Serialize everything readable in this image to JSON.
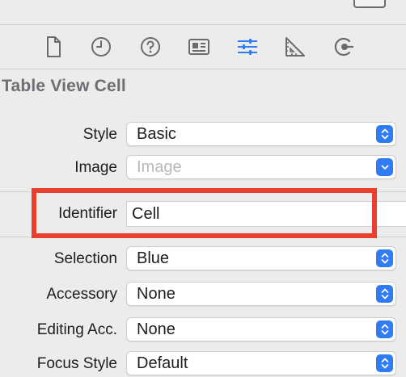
{
  "toolbar": {
    "icons": [
      "file-icon",
      "clock-icon",
      "help-icon",
      "identity-card-icon",
      "sliders-icon",
      "ruler-triangle-icon",
      "connections-icon"
    ],
    "selected": "sliders-icon",
    "accent": "#2f7cf6"
  },
  "section": {
    "title": "Table View Cell"
  },
  "fields": {
    "style": {
      "label": "Style",
      "value": "Basic"
    },
    "image": {
      "label": "Image",
      "placeholder": "Image"
    },
    "identifier": {
      "label": "Identifier",
      "value": "Cell"
    },
    "selection": {
      "label": "Selection",
      "value": "Blue"
    },
    "accessory": {
      "label": "Accessory",
      "value": "None"
    },
    "editing_acc": {
      "label": "Editing Acc.",
      "value": "None"
    },
    "focus_style": {
      "label": "Focus Style",
      "value": "Default"
    }
  },
  "highlight_color": "#e8402c"
}
